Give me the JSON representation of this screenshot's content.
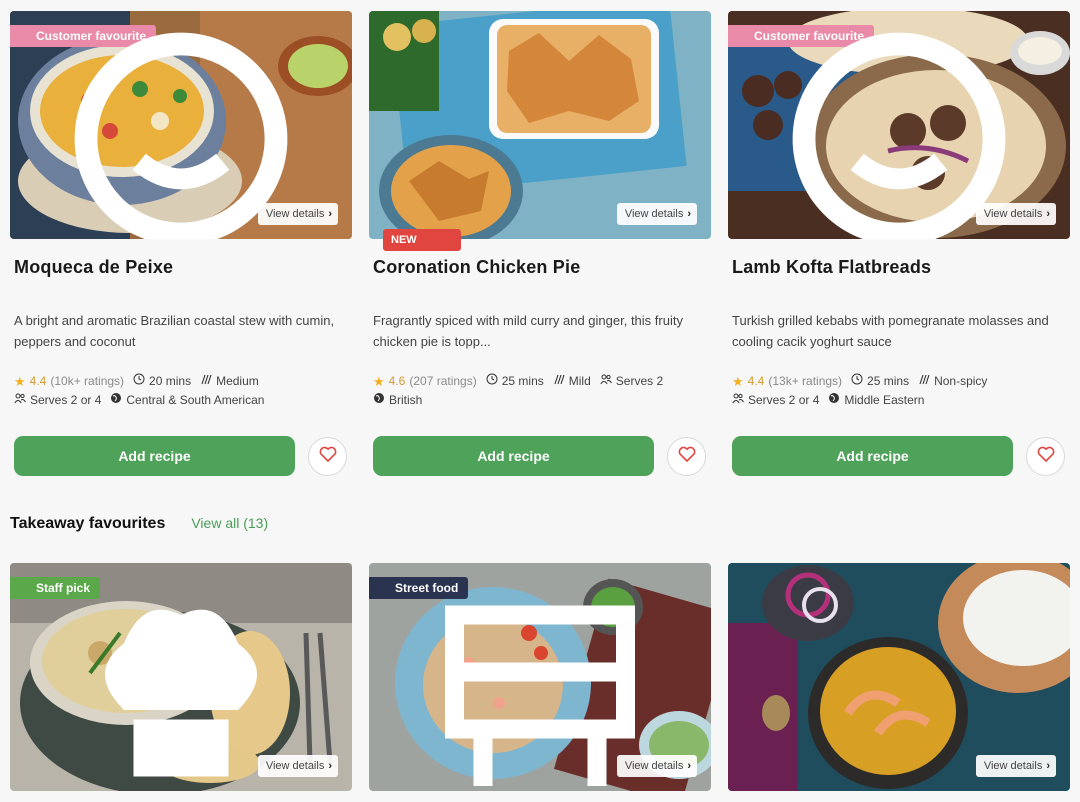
{
  "recipes": [
    {
      "ribbon": "Customer favourite",
      "view_details": "View details",
      "title": "Moqueca de Peixe",
      "description": "A bright and aromatic Brazilian coastal stew with cumin, peppers and coconut",
      "rating": "4.4",
      "ratings_count": "(10k+ ratings)",
      "time": "20 mins",
      "spice": "Medium",
      "serves": "Serves 2 or 4",
      "cuisine": "Central & South American",
      "add_label": "Add recipe"
    },
    {
      "badge": "NEW",
      "view_details": "View details",
      "title": "Coronation Chicken Pie",
      "description": "Fragrantly spiced with mild curry and ginger, this fruity chicken pie is topp...",
      "rating": "4.6",
      "ratings_count": "(207 ratings)",
      "time": "25 mins",
      "spice": "Mild",
      "serves": "Serves 2",
      "cuisine": "British",
      "add_label": "Add recipe"
    },
    {
      "ribbon": "Customer favourite",
      "view_details": "View details",
      "title": "Lamb Kofta Flatbreads",
      "description": "Turkish grilled kebabs with pomegranate molasses and cooling cacik yoghurt sauce",
      "rating": "4.4",
      "ratings_count": "(13k+ ratings)",
      "time": "25 mins",
      "spice": "Non-spicy",
      "serves": "Serves 2 or 4",
      "cuisine": "Middle Eastern",
      "add_label": "Add recipe"
    }
  ],
  "section": {
    "title": "Takeaway favourites",
    "view_all": "View all (13)"
  },
  "takeaway": [
    {
      "ribbon": "Staff pick",
      "view_details": "View details"
    },
    {
      "ribbon": "Street food",
      "view_details": "View details"
    },
    {
      "view_details": "View details"
    }
  ],
  "colors": {
    "accent_green": "#4ea25a",
    "ribbon_pink": "#e98aa8",
    "ribbon_green": "#5aa84a",
    "ribbon_navy": "#2a3350",
    "new_red": "#e0463f",
    "star": "#f2b01e"
  }
}
